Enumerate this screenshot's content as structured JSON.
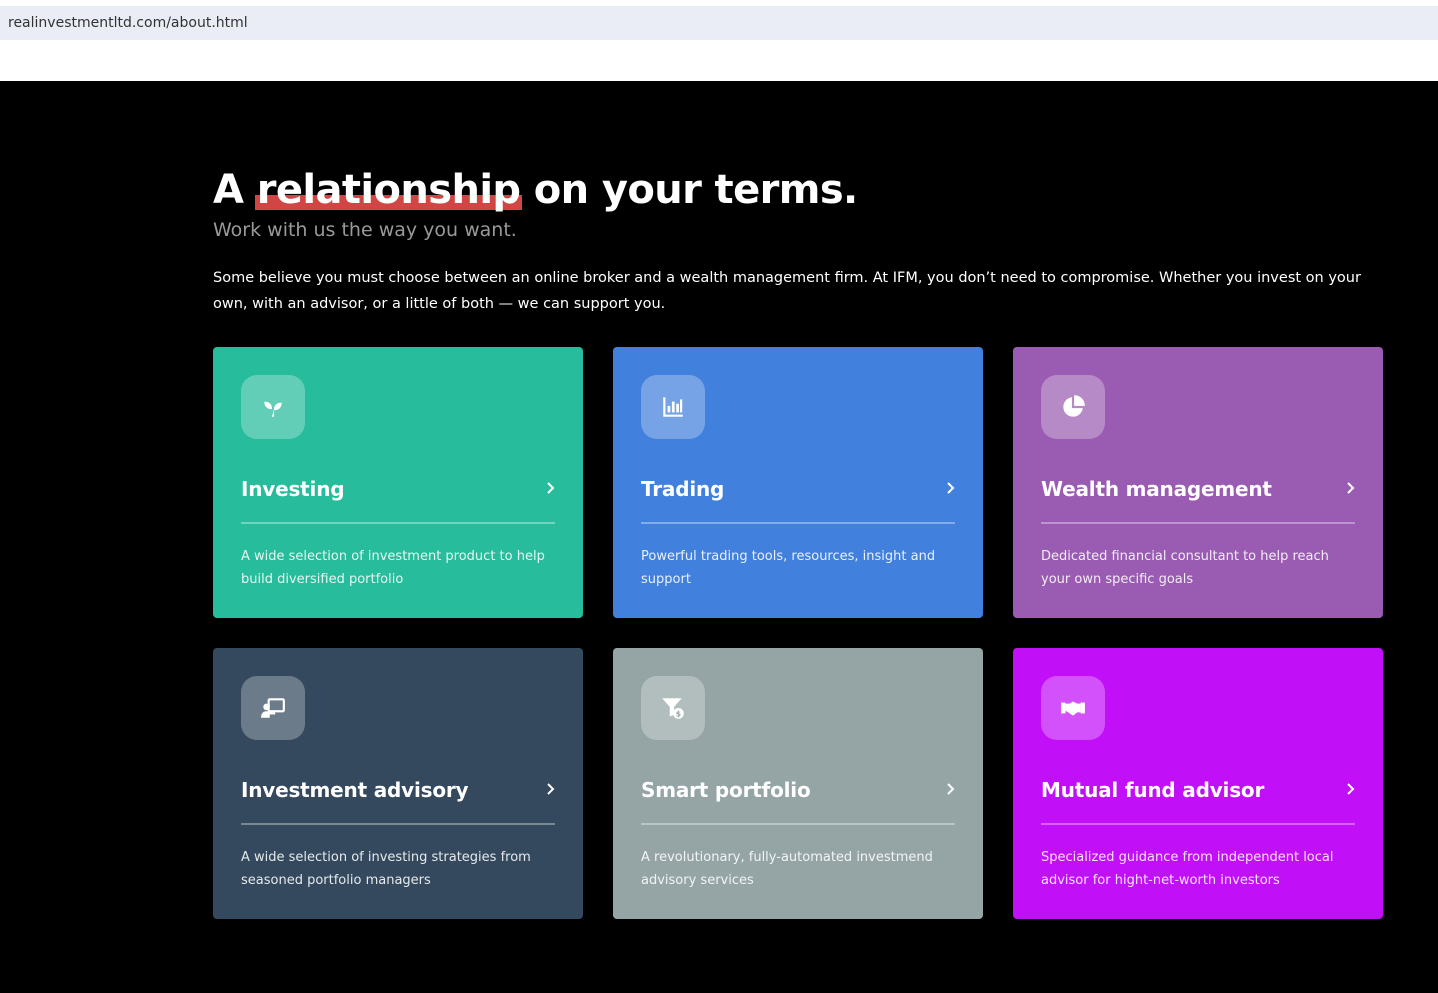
{
  "browser": {
    "url": "realinvestmentltd.com/about.html"
  },
  "hero": {
    "headline_pre": "A ",
    "headline_highlight": "relationship",
    "headline_post": " on your terms.",
    "subhead": "Work with us the way you want.",
    "intro": "Some believe you must choose between an online broker and a wealth management firm. At IFM, you don’t need to compromise. Whether you invest on your own, with an advisor, or a little of both — we can support you."
  },
  "colors": {
    "highlight_underline": "#d24545",
    "investing": "#27bc9b",
    "trading": "#4180dc",
    "wealth": "#9a5cb2",
    "advisory": "#34495e",
    "smart": "#95a5a6",
    "mutual": "#c10ff8"
  },
  "cards": [
    {
      "title": "Investing",
      "desc": "A wide selection of investment product to help build diversified portfolio",
      "icon": "seedling-icon",
      "color": "#27bc9b"
    },
    {
      "title": "Trading",
      "desc": "Powerful trading tools, resources, insight and support",
      "icon": "bar-chart-icon",
      "color": "#4180dc"
    },
    {
      "title": "Wealth management",
      "desc": "Dedicated financial consultant to help reach your own specific goals",
      "icon": "pie-chart-icon",
      "color": "#9a5cb2"
    },
    {
      "title": "Investment advisory",
      "desc": "A wide selection of investing strategies from seasoned portfolio managers",
      "icon": "presenter-board-icon",
      "color": "#34495e"
    },
    {
      "title": "Smart portfolio",
      "desc": "A revolutionary, fully-automated investmend advisory services",
      "icon": "funnel-dollar-icon",
      "color": "#95a5a6"
    },
    {
      "title": "Mutual fund advisor",
      "desc": "Specialized guidance from independent local advisor for hight-net-worth investors",
      "icon": "handshake-icon",
      "color": "#c10ff8"
    }
  ]
}
